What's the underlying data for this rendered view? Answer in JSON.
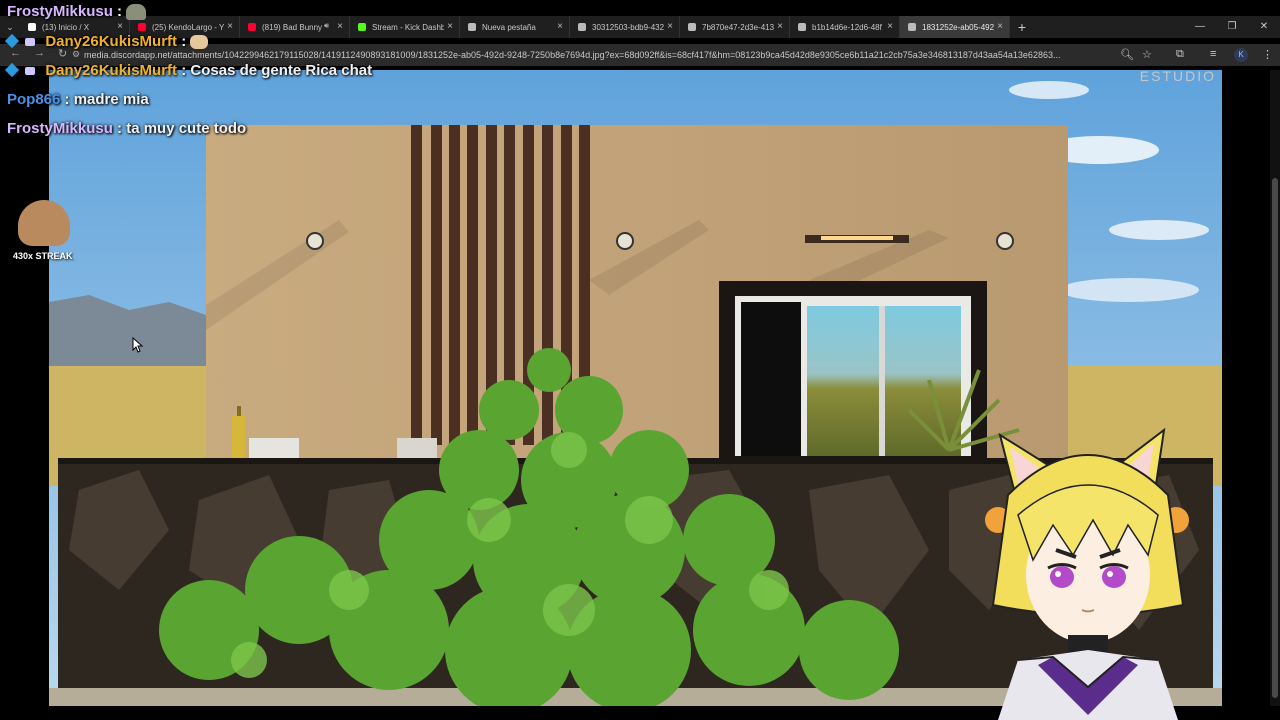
{
  "browser": {
    "tabs": [
      {
        "label": "(13) Inicio / X",
        "icon": "x-logo-icon",
        "color": "#ffffff"
      },
      {
        "label": "(25) KendoLargo - Yo",
        "icon": "youtube-icon",
        "color": "#ff0033"
      },
      {
        "label": "(819) Bad Bunny",
        "icon": "youtube-icon",
        "color": "#ff0033",
        "audio": true
      },
      {
        "label": "Stream - Kick Dashbo",
        "icon": "kick-icon",
        "color": "#53fc18"
      },
      {
        "label": "Nueva pestaña",
        "icon": "chrome-icon",
        "color": "#bbbbbb"
      },
      {
        "label": "30312503-bdb9-432",
        "icon": "globe-icon",
        "color": "#bbbbbb"
      },
      {
        "label": "7b870e47-2d3e-413",
        "icon": "globe-icon",
        "color": "#bbbbbb"
      },
      {
        "label": "b1b14d6e-12d6-48f",
        "icon": "globe-icon",
        "color": "#bbbbbb"
      },
      {
        "label": "1831252e-ab05-492",
        "icon": "globe-icon",
        "color": "#bbbbbb",
        "active": true
      }
    ],
    "url": "media.discordapp.net/attachments/1042299462179115028/1419112490893181009/1831252e-ab05-492d-9248-7250b8e7694d.jpg?ex=68d092ff&is=68cf417f&hm=08123b9ca45d42d8e9305ce6b11a21c2cb75a3e346813187d43aa54a13e62863...",
    "profile_initial": "K",
    "new_tab": "+",
    "close_glyph": "×"
  },
  "chat": [
    {
      "user": "FrostyMikkusu",
      "sep": " :",
      "message": "",
      "color": "#d7b7ff",
      "has_emote": true
    },
    {
      "user": "Dany26KukisMurft",
      "sep": " :",
      "message": "",
      "color": "#f0b22e",
      "has_emote": true,
      "badges": true
    },
    {
      "user": "Dany26KukisMurft",
      "sep": " :",
      "message": " Cosas de gente Rica chat",
      "color": "#f0b22e",
      "badges": true
    },
    {
      "user": "Pop866",
      "sep": " :",
      "message": " madre mia",
      "color": "#4a8fe8"
    },
    {
      "user": "FrostyMikkusu",
      "sep": " :",
      "message": " ta muy cute todo",
      "color": "#d7b7ff"
    }
  ],
  "streak": "430x STREAK",
  "watermark": "ESTUDIO",
  "colors": {
    "wall": "#c4a57c",
    "sky": "#8fc0e8",
    "stone": "#3a3128",
    "foliage": "#4e9a2c",
    "vtuber_hair": "#f5e46a"
  }
}
